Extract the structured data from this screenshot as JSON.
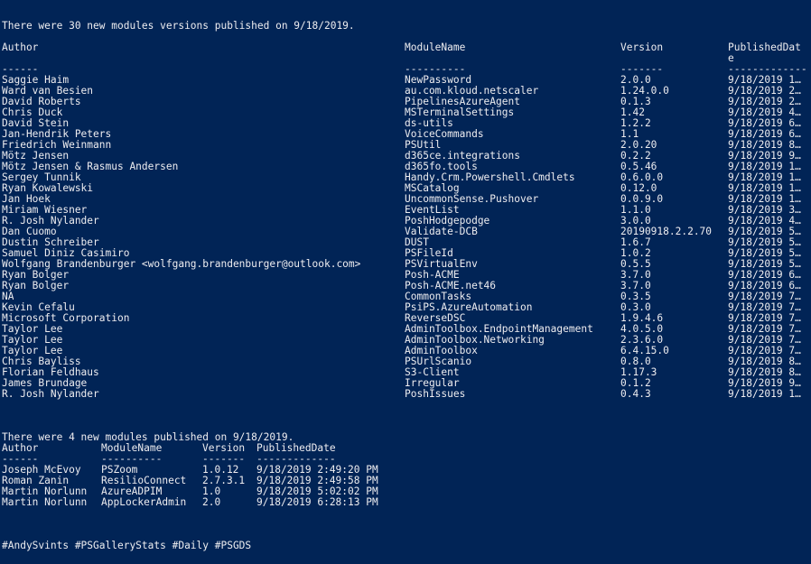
{
  "summary1": "There were 30 new modules versions published on 9/18/2019.",
  "table1": {
    "headers": [
      "Author",
      "ModuleName",
      "Version",
      "PublishedDate"
    ],
    "header_last_wrapped": [
      "PublishedDat",
      "e"
    ],
    "separators": [
      "------",
      "----------",
      "-------",
      "-------------"
    ],
    "rows": [
      [
        "Saggie Haim",
        "NewPassword",
        "2.0.0",
        "9/18/2019 1…"
      ],
      [
        "Ward van Besien",
        "au.com.kloud.netscaler",
        "1.24.0.0",
        "9/18/2019 2…"
      ],
      [
        "David Roberts",
        "PipelinesAzureAgent",
        "0.1.3",
        "9/18/2019 2…"
      ],
      [
        "Chris Duck",
        "MSTerminalSettings",
        "1.42",
        "9/18/2019 4…"
      ],
      [
        "David Stein",
        "ds-utils",
        "1.2.2",
        "9/18/2019 6…"
      ],
      [
        "Jan-Hendrik Peters",
        "VoiceCommands",
        "1.1",
        "9/18/2019 6…"
      ],
      [
        "Friedrich Weinmann",
        "PSUtil",
        "2.0.20",
        "9/18/2019 8…"
      ],
      [
        "Mötz Jensen",
        "d365ce.integrations",
        "0.2.2",
        "9/18/2019 9…"
      ],
      [
        "Mötz Jensen & Rasmus Andersen",
        "d365fo.tools",
        "0.5.46",
        "9/18/2019 1…"
      ],
      [
        "Sergey Tunnik",
        "Handy.Crm.Powershell.Cmdlets",
        "0.6.0.0",
        "9/18/2019 1…"
      ],
      [
        "Ryan Kowalewski",
        "MSCatalog",
        "0.12.0",
        "9/18/2019 1…"
      ],
      [
        "Jan Hoek",
        "UncommonSense.Pushover",
        "0.0.9.0",
        "9/18/2019 1…"
      ],
      [
        "Miriam Wiesner",
        "EventList",
        "1.1.0",
        "9/18/2019 3…"
      ],
      [
        "R. Josh Nylander",
        "PoshHodgepodge",
        "3.0.0",
        "9/18/2019 4…"
      ],
      [
        "Dan Cuomo",
        "Validate-DCB",
        "20190918.2.2.70",
        "9/18/2019 5…"
      ],
      [
        "Dustin Schreiber",
        "DUST",
        "1.6.7",
        "9/18/2019 5…"
      ],
      [
        "Samuel Diniz Casimiro",
        "PSFileId",
        "1.0.2",
        "9/18/2019 5…"
      ],
      [
        "Wolfgang Brandenburger <wolfgang.brandenburger@outlook.com>",
        "PSVirtualEnv",
        "0.5.5",
        "9/18/2019 5…"
      ],
      [
        "Ryan Bolger",
        "Posh-ACME",
        "3.7.0",
        "9/18/2019 6…"
      ],
      [
        "Ryan Bolger",
        "Posh-ACME.net46",
        "3.7.0",
        "9/18/2019 6…"
      ],
      [
        "NA",
        "CommonTasks",
        "0.3.5",
        "9/18/2019 7…"
      ],
      [
        "Kevin Cefalu",
        "PsiPS.AzureAutomation",
        "0.3.0",
        "9/18/2019 7…"
      ],
      [
        "Microsoft Corporation",
        "ReverseDSC",
        "1.9.4.6",
        "9/18/2019 7…"
      ],
      [
        "Taylor Lee",
        "AdminToolbox.EndpointManagement",
        "4.0.5.0",
        "9/18/2019 7…"
      ],
      [
        "Taylor Lee",
        "AdminToolbox.Networking",
        "2.3.6.0",
        "9/18/2019 7…"
      ],
      [
        "Taylor Lee",
        "AdminToolbox",
        "6.4.15.0",
        "9/18/2019 7…"
      ],
      [
        "Chris Bayliss",
        "PSUrlScanio",
        "0.8.0",
        "9/18/2019 8…"
      ],
      [
        "Florian Feldhaus",
        "S3-Client",
        "1.17.3",
        "9/18/2019 8…"
      ],
      [
        "James Brundage",
        "Irregular",
        "0.1.2",
        "9/18/2019 9…"
      ],
      [
        "R. Josh Nylander",
        "PoshIssues",
        "0.4.3",
        "9/18/2019 1…"
      ]
    ]
  },
  "summary2": "There were 4 new modules published on 9/18/2019.",
  "table2": {
    "headers": [
      "Author",
      "ModuleName",
      "Version",
      "PublishedDate"
    ],
    "separators": [
      "------",
      "----------",
      "-------",
      "-------------"
    ],
    "rows": [
      [
        "Joseph McEvoy",
        "PSZoom",
        "1.0.12",
        "9/18/2019 2:49:20 PM"
      ],
      [
        "Roman Zanin",
        "ResilioConnect",
        "2.7.3.1",
        "9/18/2019 2:49:58 PM"
      ],
      [
        "Martin Norlunn",
        "AzureADPIM",
        "1.0",
        "9/18/2019 5:02:02 PM"
      ],
      [
        "Martin Norlunn",
        "AppLockerAdmin",
        "2.0",
        "9/18/2019 6:28:13 PM"
      ]
    ]
  },
  "hashtags": "#AndySvints #PSGalleryStats #Daily #PSGDS",
  "colors": {
    "background": "#012456",
    "foreground": "#eeedf0"
  }
}
